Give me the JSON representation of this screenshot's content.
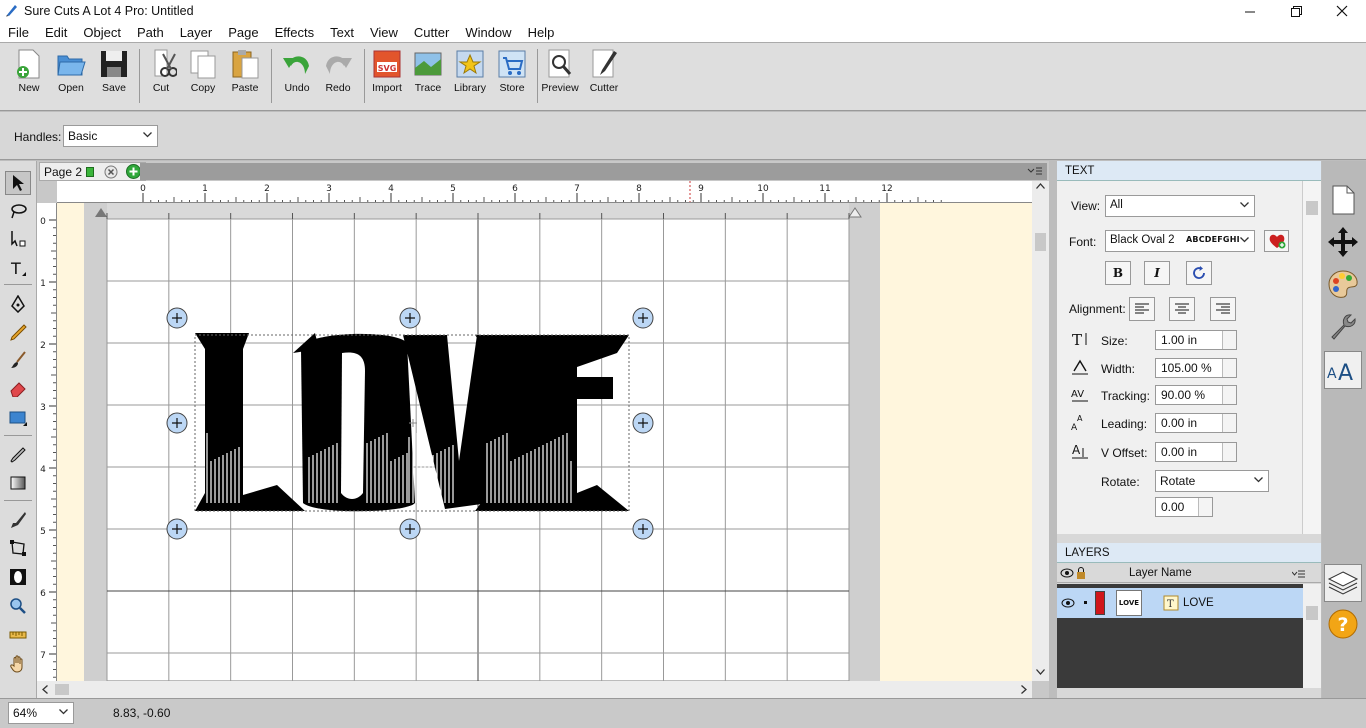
{
  "window": {
    "title": "Sure Cuts A Lot 4 Pro: Untitled"
  },
  "menu": [
    "File",
    "Edit",
    "Object",
    "Path",
    "Layer",
    "Page",
    "Effects",
    "Text",
    "View",
    "Cutter",
    "Window",
    "Help"
  ],
  "toolbar": {
    "new": "New",
    "open": "Open",
    "save": "Save",
    "cut": "Cut",
    "copy": "Copy",
    "paste": "Paste",
    "undo": "Undo",
    "redo": "Redo",
    "import": "Import",
    "trace": "Trace",
    "library": "Library",
    "store": "Store",
    "preview": "Preview",
    "cutter": "Cutter"
  },
  "propbar": {
    "handles_label": "Handles:",
    "handles_value": "Basic"
  },
  "doc": {
    "page_tab": "Page 2",
    "hruler_labels": [
      "0",
      "1",
      "2",
      "3",
      "4",
      "5",
      "6",
      "7",
      "8",
      "9",
      "10",
      "11",
      "12"
    ],
    "vruler_labels": [
      "0",
      "1",
      "2",
      "3",
      "4",
      "5",
      "6",
      "7"
    ],
    "artwork_text": "LOVE"
  },
  "text_panel": {
    "header": "TEXT",
    "view_label": "View:",
    "view_value": "All",
    "font_label": "Font:",
    "font_value": "Black Oval 2",
    "font_preview": "ABCDEFGHI",
    "bold": "B",
    "italic": "I",
    "alignment_label": "Alignment:",
    "size_label": "Size:",
    "size_value": "1.00 in",
    "width_label": "Width:",
    "width_value": "105.00 %",
    "tracking_label": "Tracking:",
    "tracking_value": "90.00 %",
    "leading_label": "Leading:",
    "leading_value": "0.00 in",
    "voffset_label": "V Offset:",
    "voffset_value": "0.00 in",
    "rotate_label": "Rotate:",
    "rotate_value": "Rotate",
    "rotate_amount": "0.00"
  },
  "layers_panel": {
    "header": "LAYERS",
    "column_name": "Layer Name",
    "layer": {
      "thumb": "LOVE",
      "name": "LOVE",
      "color": "#d0161b"
    }
  },
  "status": {
    "zoom": "64%",
    "coords": "8.83, -0.60"
  },
  "colors": {
    "selection_blue": "#bcd7f5",
    "canvas_bg": "#fff6dd",
    "layer_red": "#d0161b"
  }
}
